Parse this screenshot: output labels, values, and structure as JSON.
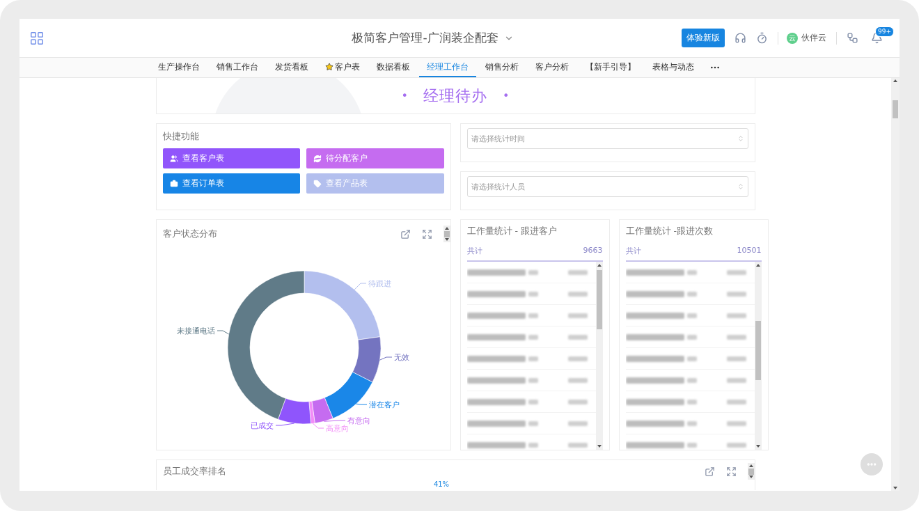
{
  "header": {
    "title": "极简客户管理-广润装企配套",
    "trial_button": "体验新版",
    "user": {
      "avatar": "云",
      "name": "伙伴云"
    },
    "notification_badge": "99+"
  },
  "tabs": [
    {
      "label": "生产操作台",
      "selected": false
    },
    {
      "label": "销售工作台",
      "selected": false
    },
    {
      "label": "发货看板",
      "selected": false
    },
    {
      "label": "客户表",
      "selected": false,
      "kind": "starred"
    },
    {
      "label": "数据看板",
      "selected": false
    },
    {
      "label": "经理工作台",
      "selected": true
    },
    {
      "label": "销售分析",
      "selected": false
    },
    {
      "label": "客户分析",
      "selected": false
    },
    {
      "label": "【新手引导】",
      "selected": false
    },
    {
      "label": "表格与动态",
      "selected": false
    }
  ],
  "banner": {
    "title": "经理待办",
    "dot_left": "•",
    "dot_right": "•"
  },
  "quick_functions": {
    "title": "快捷功能",
    "buttons": [
      {
        "label": "查看客户表",
        "color": "#9155fb",
        "kind": "users"
      },
      {
        "label": "待分配客户",
        "color": "#c56cf0",
        "kind": "refresh"
      },
      {
        "label": "查看订单表",
        "color": "#1785e6",
        "kind": "briefcase"
      },
      {
        "label": "查看产品表",
        "color": "#b3bfee",
        "kind": "tag"
      }
    ]
  },
  "filters": [
    {
      "placeholder": "请选择统计时间"
    },
    {
      "placeholder": "请选择统计人员"
    }
  ],
  "status_chart": {
    "title": "客户状态分布",
    "slices": [
      {
        "label": "待跟进",
        "color": "#b3bfee"
      },
      {
        "label": "无效",
        "color": "#7474c0"
      },
      {
        "label": "潜在客户",
        "color": "#1a87e8"
      },
      {
        "label": "有意向",
        "color": "#c56cf0"
      },
      {
        "label": "高意向",
        "color": "#f28cf7"
      },
      {
        "label": "已成交",
        "color": "#8f55fc"
      },
      {
        "label": "未接通电话",
        "color": "#607b88"
      }
    ]
  },
  "workload_lists": [
    {
      "title": "工作量统计 - 跟进客户",
      "total_label": "共计",
      "total": "9663",
      "rows": [
        {
          "kind": "redacted"
        },
        {
          "kind": "redacted"
        },
        {
          "kind": "redacted"
        },
        {
          "kind": "redacted"
        },
        {
          "kind": "redacted"
        },
        {
          "kind": "redacted"
        },
        {
          "kind": "redacted"
        },
        {
          "kind": "redacted"
        },
        {
          "kind": "redacted"
        }
      ]
    },
    {
      "title": "工作量统计 -跟进次数",
      "total_label": "共计",
      "total": "10501",
      "rows": [
        {
          "kind": "redacted"
        },
        {
          "kind": "redacted"
        },
        {
          "kind": "redacted"
        },
        {
          "kind": "redacted"
        },
        {
          "kind": "redacted"
        },
        {
          "kind": "redacted"
        },
        {
          "kind": "redacted"
        },
        {
          "kind": "redacted"
        },
        {
          "kind": "redacted"
        }
      ]
    }
  ],
  "ranking": {
    "title": "员工成交率排名",
    "top_value": "41%"
  }
}
